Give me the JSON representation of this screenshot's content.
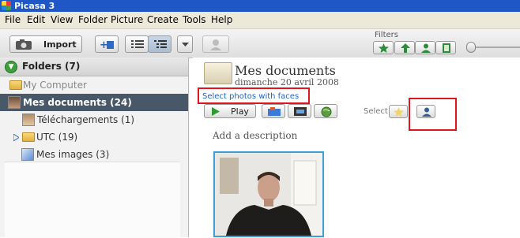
{
  "window": {
    "title": "Picasa 3"
  },
  "menu": [
    "File",
    "Edit",
    "View",
    "Folder",
    "Picture",
    "Create",
    "Tools",
    "Help"
  ],
  "toolbar": {
    "import_label": "Import",
    "filters_label": "Filters"
  },
  "sidebar": {
    "header": "Folders (7)",
    "items": [
      {
        "label": "My Computer",
        "icon": "folder-icon"
      },
      {
        "label": "Mes documents (24)",
        "icon": "face-thumb-icon",
        "selected": true
      },
      {
        "label": "Téléchargements (1)",
        "icon": "folder-thumb-icon"
      },
      {
        "label": "UTC (19)",
        "icon": "folder-icon"
      },
      {
        "label": "Mes images (3)",
        "icon": "images-icon"
      }
    ]
  },
  "main": {
    "title": "Mes documents",
    "date": "dimanche 20 avril 2008",
    "hint": "Select photos with faces",
    "play_label": "Play",
    "select_label": "Select",
    "add_description": "Add a description"
  },
  "colors": {
    "highlight": "#e0161c",
    "selection": "#485869",
    "link": "#1b64c4",
    "photo_border": "#3b9fd8"
  }
}
